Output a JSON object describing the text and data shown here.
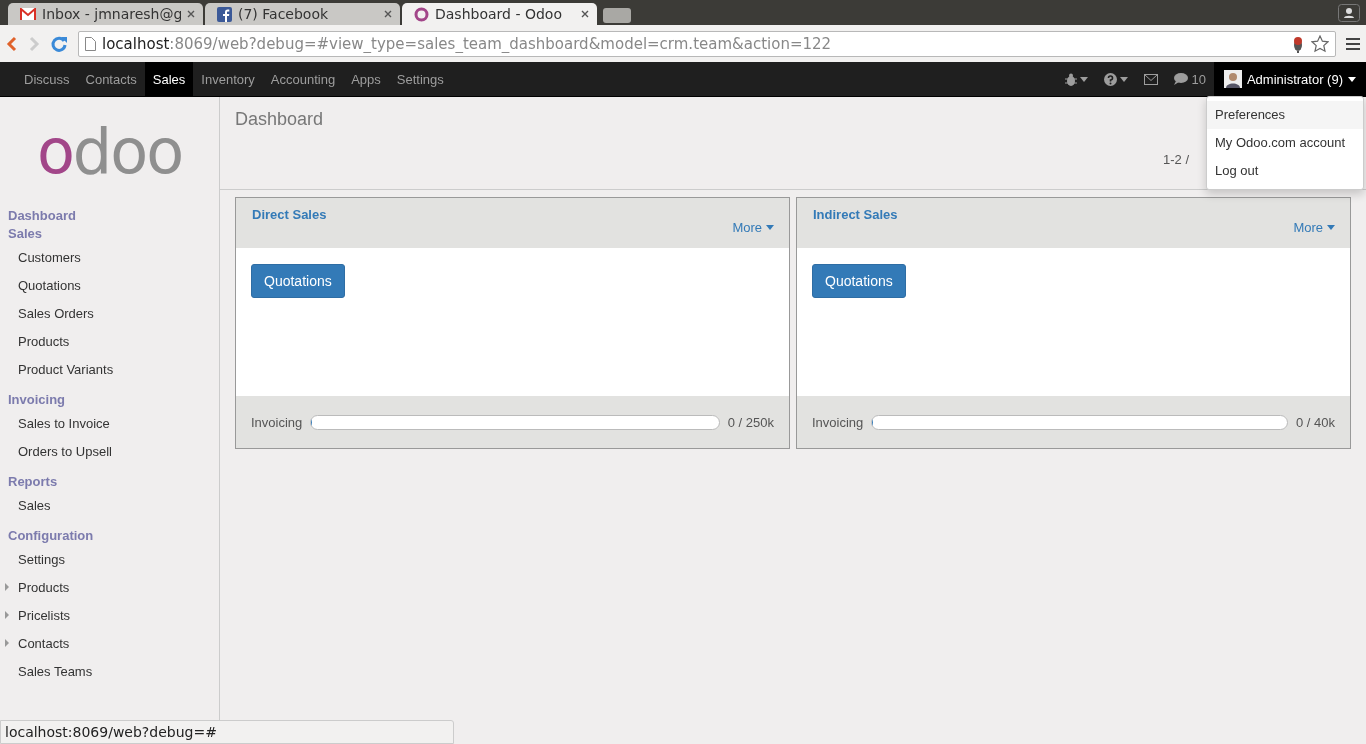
{
  "browser": {
    "tabs": [
      {
        "title": "Inbox - jmnaresh@g",
        "kind": "mail",
        "selected": false
      },
      {
        "title": "(7) Facebook",
        "kind": "facebook",
        "selected": false
      },
      {
        "title": "Dashboard - Odoo",
        "kind": "odoo",
        "selected": true
      }
    ],
    "url": {
      "host": "localhost",
      "path": ":8069/web?debug=#view_type=sales_team_dashboard&model=crm.team&action=122"
    },
    "status_url": "localhost:8069/web?debug=#"
  },
  "topbar": {
    "apps": [
      {
        "label": "Discuss",
        "selected": false
      },
      {
        "label": "Contacts",
        "selected": false
      },
      {
        "label": "Sales",
        "selected": true
      },
      {
        "label": "Inventory",
        "selected": false
      },
      {
        "label": "Accounting",
        "selected": false
      },
      {
        "label": "Apps",
        "selected": false
      },
      {
        "label": "Settings",
        "selected": false
      }
    ],
    "chat_count": "10",
    "user": {
      "name": "Administrator (9)",
      "expanded": true,
      "menu": [
        {
          "label": "Preferences",
          "selected": true
        },
        {
          "label": "My Odoo.com account",
          "selected": false
        },
        {
          "label": "Log out",
          "selected": false
        }
      ]
    }
  },
  "sidebar": {
    "logo": "odoo",
    "sections": [
      {
        "title": "Dashboard"
      },
      {
        "title": "Sales",
        "items": [
          {
            "label": "Customers",
            "expandable": false
          },
          {
            "label": "Quotations",
            "expandable": false
          },
          {
            "label": "Sales Orders",
            "expandable": false
          },
          {
            "label": "Products",
            "expandable": false
          },
          {
            "label": "Product Variants",
            "expandable": false
          }
        ]
      },
      {
        "title": "Invoicing",
        "items": [
          {
            "label": "Sales to Invoice",
            "expandable": false
          },
          {
            "label": "Orders to Upsell",
            "expandable": false
          }
        ]
      },
      {
        "title": "Reports",
        "items": [
          {
            "label": "Sales",
            "expandable": false
          }
        ]
      },
      {
        "title": "Configuration",
        "items": [
          {
            "label": "Settings",
            "expandable": false
          },
          {
            "label": "Products",
            "expandable": true
          },
          {
            "label": "Pricelists",
            "expandable": true
          },
          {
            "label": "Contacts",
            "expandable": true
          },
          {
            "label": "Sales Teams",
            "expandable": false
          }
        ]
      }
    ]
  },
  "main": {
    "title": "Dashboard",
    "pager": "1-2 /",
    "teams": [
      {
        "name": "Direct Sales",
        "more": "More",
        "button": "Quotations",
        "bar_label": "Invoicing",
        "level": 0,
        "reading": "0 / 250k"
      },
      {
        "name": "Indirect Sales",
        "more": "More",
        "button": "Quotations",
        "bar_label": "Invoicing",
        "level": 0,
        "reading": "0 / 40k"
      }
    ]
  }
}
